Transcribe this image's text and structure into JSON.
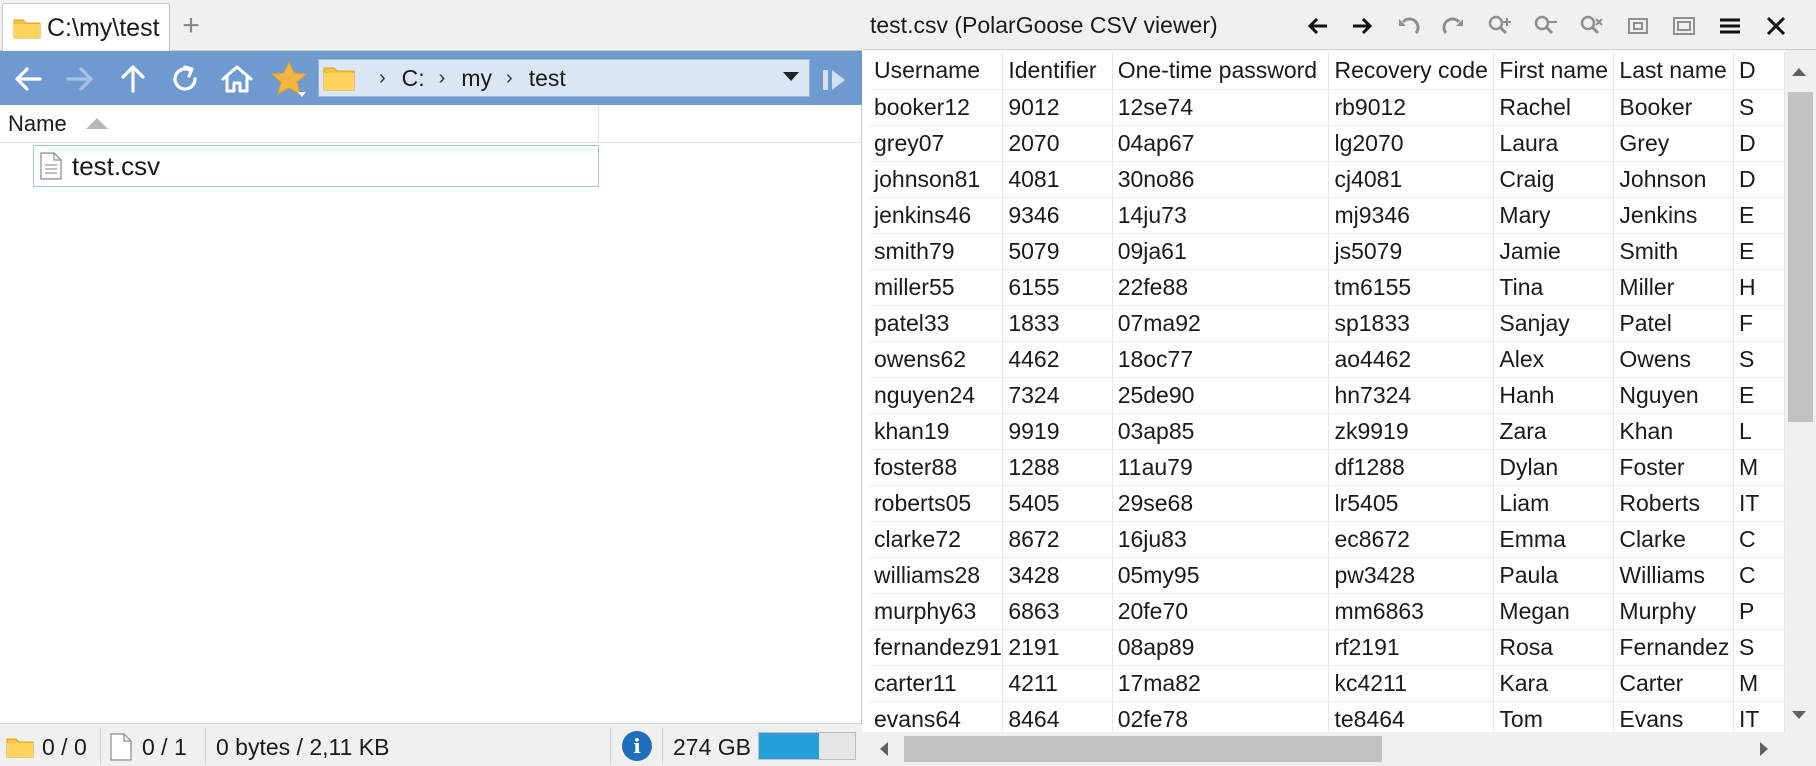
{
  "left_pane": {
    "tab": {
      "title": "C:\\my\\test",
      "new_tab": "+"
    },
    "breadcrumb": [
      "C:",
      "my",
      "test"
    ],
    "column_header": {
      "name": "Name"
    },
    "files": [
      {
        "name": "test.csv"
      }
    ],
    "status": {
      "folders": "0 / 0",
      "files": "0 / 1",
      "size": "0 bytes / 2,11 KB",
      "free_space": "274 GB",
      "disk_used_fraction": 0.62
    }
  },
  "viewer": {
    "title": "test.csv (PolarGoose CSV viewer)",
    "columns": [
      "Username",
      "Identifier",
      "One-time password",
      "Recovery code",
      "First name",
      "Last name",
      "D"
    ],
    "rows": [
      [
        "booker12",
        "9012",
        "12se74",
        "rb9012",
        "Rachel",
        "Booker",
        "S"
      ],
      [
        "grey07",
        "2070",
        "04ap67",
        "lg2070",
        "Laura",
        "Grey",
        "D"
      ],
      [
        "johnson81",
        "4081",
        "30no86",
        "cj4081",
        "Craig",
        "Johnson",
        "D"
      ],
      [
        "jenkins46",
        "9346",
        "14ju73",
        "mj9346",
        "Mary",
        "Jenkins",
        "E"
      ],
      [
        "smith79",
        "5079",
        "09ja61",
        "js5079",
        "Jamie",
        "Smith",
        "E"
      ],
      [
        "miller55",
        "6155",
        "22fe88",
        "tm6155",
        "Tina",
        "Miller",
        "H"
      ],
      [
        "patel33",
        "1833",
        "07ma92",
        "sp1833",
        "Sanjay",
        "Patel",
        "F"
      ],
      [
        "owens62",
        "4462",
        "18oc77",
        "ao4462",
        "Alex",
        "Owens",
        "S"
      ],
      [
        "nguyen24",
        "7324",
        "25de90",
        "hn7324",
        "Hanh",
        "Nguyen",
        "E"
      ],
      [
        "khan19",
        "9919",
        "03ap85",
        "zk9919",
        "Zara",
        "Khan",
        "L"
      ],
      [
        "foster88",
        "1288",
        "11au79",
        "df1288",
        "Dylan",
        "Foster",
        "M"
      ],
      [
        "roberts05",
        "5405",
        "29se68",
        "lr5405",
        "Liam",
        "Roberts",
        "IT"
      ],
      [
        "clarke72",
        "8672",
        "16ju83",
        "ec8672",
        "Emma",
        "Clarke",
        "C"
      ],
      [
        "williams28",
        "3428",
        "05my95",
        "pw3428",
        "Paula",
        "Williams",
        "C"
      ],
      [
        "murphy63",
        "6863",
        "20fe70",
        "mm6863",
        "Megan",
        "Murphy",
        "P"
      ],
      [
        "fernandez91",
        "2191",
        "08ap89",
        "rf2191",
        "Rosa",
        "Fernandez",
        "S"
      ],
      [
        "carter11",
        "4211",
        "17ma82",
        "kc4211",
        "Kara",
        "Carter",
        "M"
      ],
      [
        "evans64",
        "8464",
        "02fe78",
        "te8464",
        "Tom",
        "Evans",
        "IT"
      ]
    ]
  },
  "colors": {
    "nav_bar": "#6f9ad0",
    "address_bar": "#dbe6f4",
    "selection_border": "#99c9ef",
    "folder": "#f5c242",
    "disk_fill": "#26a0da",
    "info": "#1f6fbf"
  },
  "icons": {
    "nav": [
      "back-arrow-icon",
      "forward-arrow-icon",
      "up-arrow-icon",
      "refresh-icon",
      "home-icon",
      "star-icon"
    ],
    "viewer_toolbar": [
      "back-icon",
      "forward-icon",
      "undo-icon",
      "redo-icon",
      "zoom-in-icon",
      "zoom-out-icon",
      "zoom-reset-icon",
      "restore-icon",
      "maximize-icon",
      "menu-icon",
      "close-icon"
    ]
  }
}
